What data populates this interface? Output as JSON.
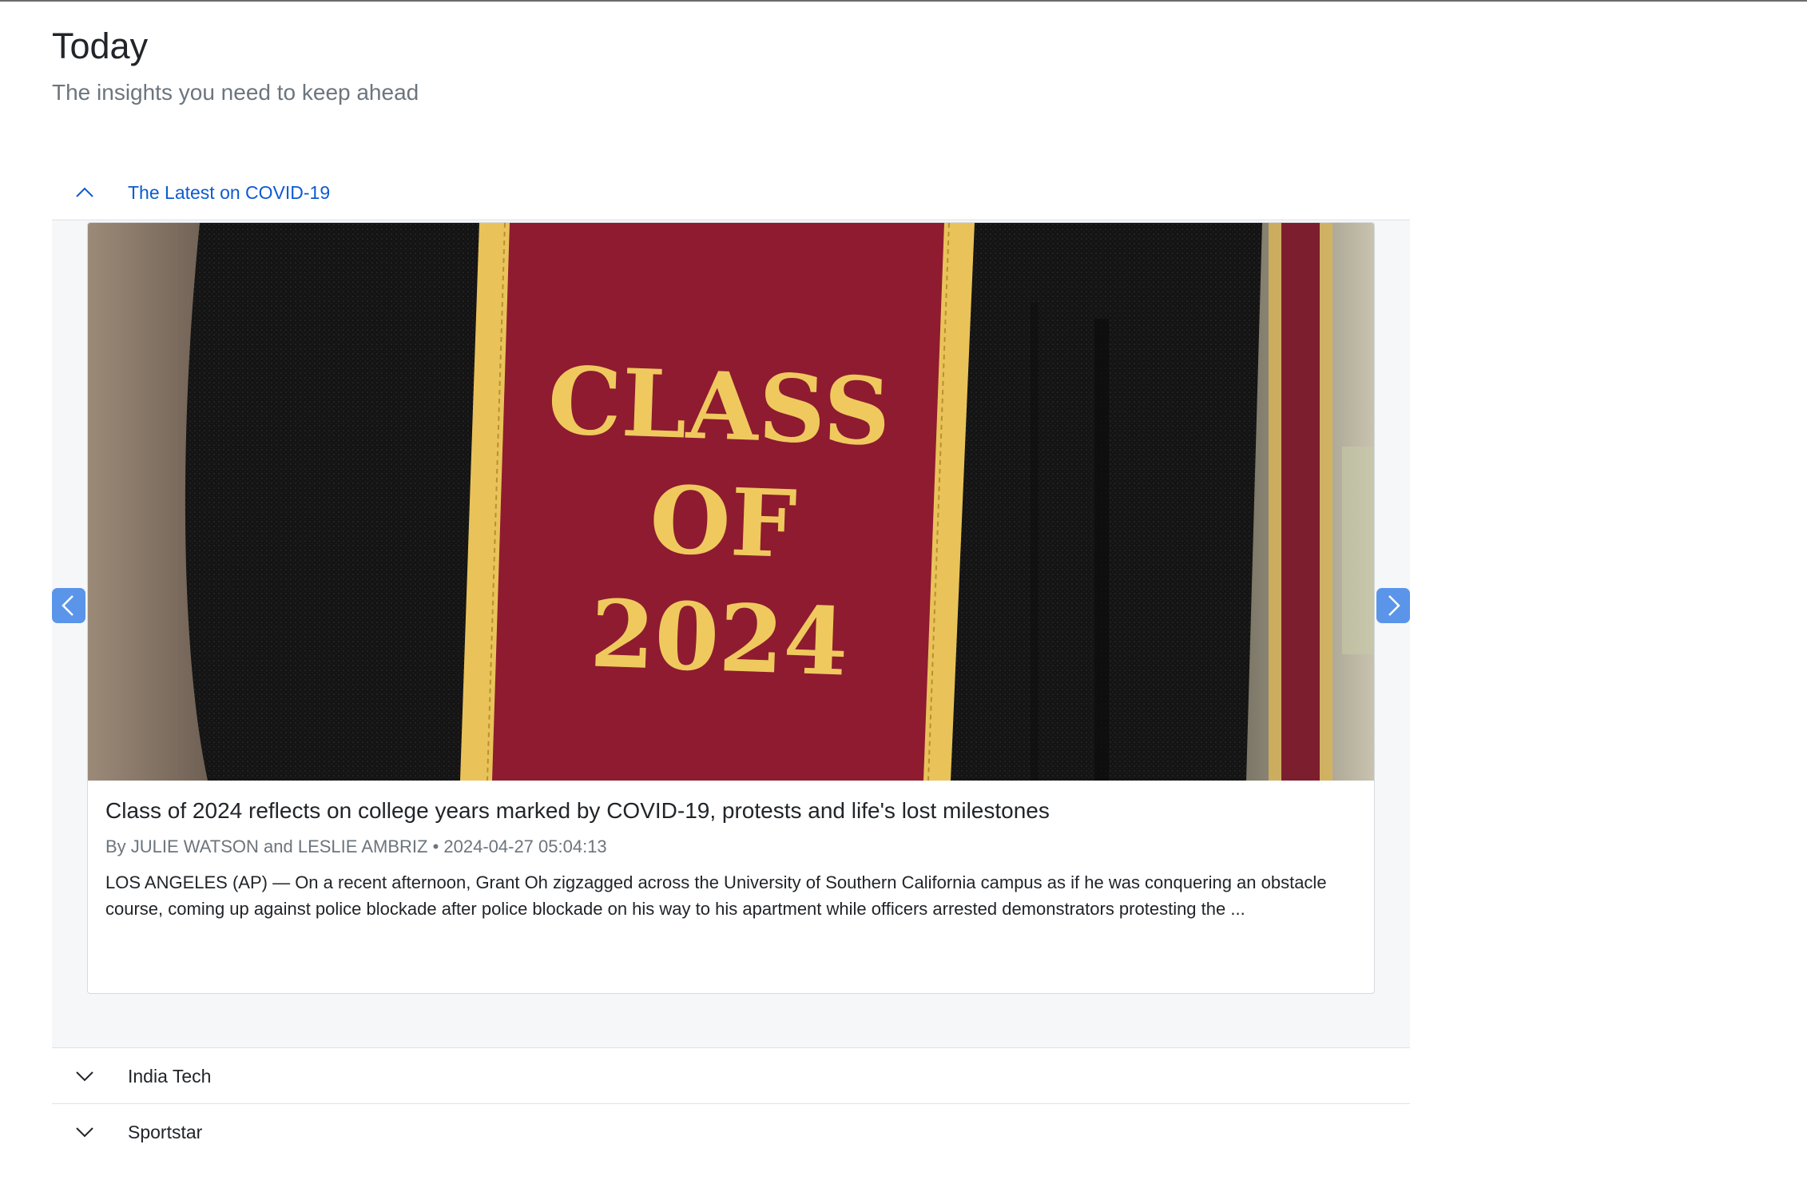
{
  "page": {
    "title": "Today",
    "subtitle": "The insights you need to keep ahead"
  },
  "accordion": {
    "sections": [
      {
        "label": "The Latest on COVID-19",
        "expanded": true,
        "icon": "chevron-up-icon"
      },
      {
        "label": "India Tech",
        "expanded": false,
        "icon": "chevron-down-icon"
      },
      {
        "label": "Sportstar",
        "expanded": false,
        "icon": "chevron-down-icon"
      }
    ]
  },
  "carousel": {
    "prev_icon": "chevron-left-icon",
    "next_icon": "chevron-right-icon",
    "active_card": {
      "image_text": [
        "CLASS",
        "OF",
        "2024"
      ],
      "headline": "Class of 2024 reflects on college years marked by COVID-19, protests and life's lost milestones",
      "meta": "By JULIE WATSON and LESLIE AMBRIZ • 2024-04-27 05:04:13",
      "summary": "LOS ANGELES (AP) — On a recent afternoon, Grant Oh zigzagged across the University of Southern California campus as if he was conquering an obstacle course, coming up against police blockade after police blockade on his way to his apartment while officers arrested demonstrators protesting the ..."
    }
  },
  "colors": {
    "accent": "#0d5bd1",
    "carousel_button": "#5a95ea",
    "stole_red": "#8e1b30",
    "stole_gold": "#e9c35a"
  }
}
